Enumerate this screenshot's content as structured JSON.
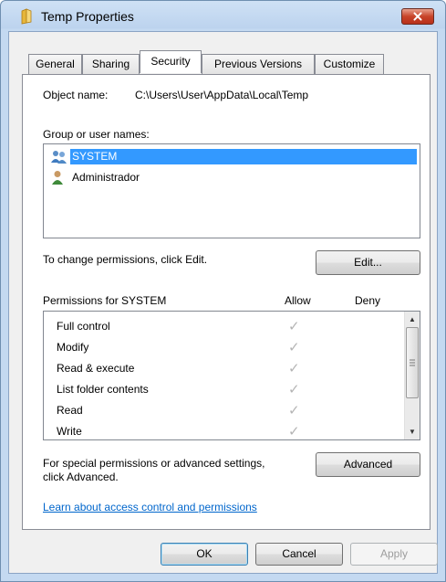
{
  "window": {
    "title": "Temp Properties"
  },
  "tabs": [
    {
      "label": "General"
    },
    {
      "label": "Sharing"
    },
    {
      "label": "Security"
    },
    {
      "label": "Previous Versions"
    },
    {
      "label": "Customize"
    }
  ],
  "security": {
    "object_name_label": "Object name:",
    "object_name_value": "C:\\Users\\User\\AppData\\Local\\Temp",
    "group_label": "Group or user names:",
    "users": [
      {
        "name": "SYSTEM",
        "selected": true
      },
      {
        "name": "Administrador",
        "selected": false
      }
    ],
    "change_text": "To change permissions, click Edit.",
    "edit_button": "Edit...",
    "permissions_label": "Permissions for SYSTEM",
    "allow_header": "Allow",
    "deny_header": "Deny",
    "permissions": [
      {
        "name": "Full control",
        "allow": "✓"
      },
      {
        "name": "Modify",
        "allow": "✓"
      },
      {
        "name": "Read & execute",
        "allow": "✓"
      },
      {
        "name": "List folder contents",
        "allow": "✓"
      },
      {
        "name": "Read",
        "allow": "✓"
      },
      {
        "name": "Write",
        "allow": "✓"
      }
    ],
    "special_text_1": "For special permissions or advanced settings,",
    "special_text_2": "click Advanced.",
    "advanced_button": "Advanced",
    "learn_link": "Learn about access control and permissions"
  },
  "footer": {
    "ok": "OK",
    "cancel": "Cancel",
    "apply": "Apply"
  },
  "colors": {
    "selection": "#3399ff",
    "link": "#0066cc",
    "close": "#c8442a"
  }
}
